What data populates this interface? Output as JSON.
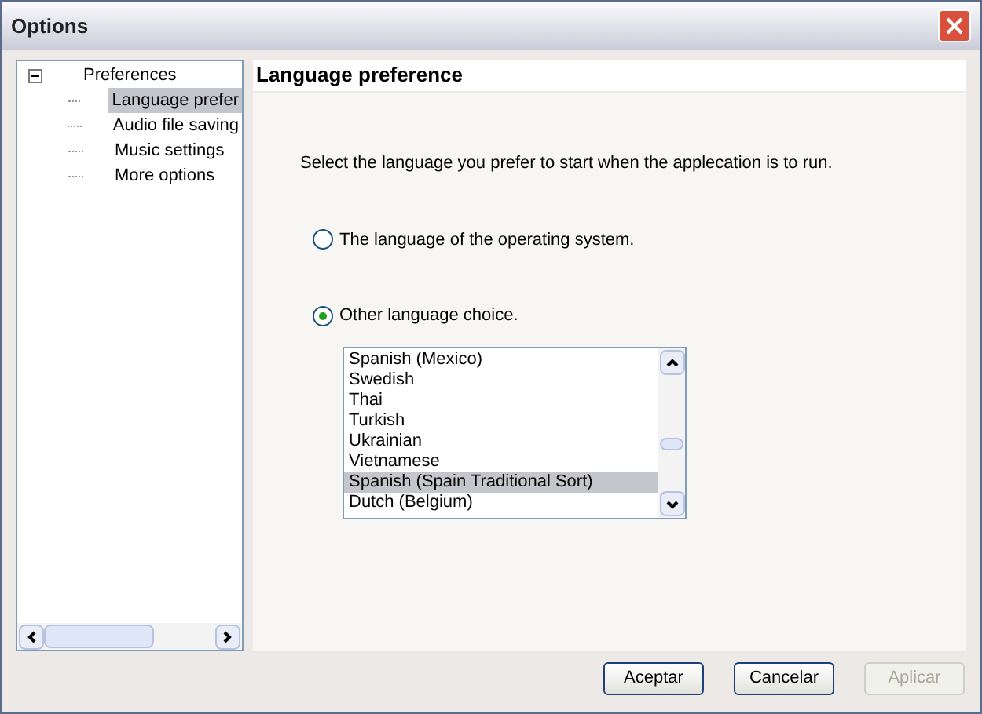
{
  "window": {
    "title": "Options"
  },
  "tree": [
    {
      "label": "Preferences",
      "expanded": true,
      "selected": false,
      "children": [
        {
          "label": "Language prefer",
          "selected": true
        },
        {
          "label": "Audio file saving",
          "selected": false
        },
        {
          "label": "Music settings",
          "selected": false
        },
        {
          "label": "More options",
          "selected": false
        }
      ]
    }
  ],
  "panel": {
    "title": "Language preference",
    "instruction": "Select the language you prefer to start when the applecation is to run.",
    "options": [
      {
        "label": "The language of the operating system.",
        "selected": false
      },
      {
        "label": "Other language choice.",
        "selected": true
      }
    ],
    "languages": [
      {
        "label": "Spanish (Mexico)",
        "selected": false
      },
      {
        "label": "Swedish",
        "selected": false
      },
      {
        "label": "Thai",
        "selected": false
      },
      {
        "label": "Turkish",
        "selected": false
      },
      {
        "label": "Ukrainian",
        "selected": false
      },
      {
        "label": "Vietnamese",
        "selected": false
      },
      {
        "label": "Spanish (Spain Traditional Sort)",
        "selected": true
      },
      {
        "label": "Dutch (Belgium)",
        "selected": false
      }
    ]
  },
  "buttons": [
    {
      "label": "Aceptar",
      "disabled": false
    },
    {
      "label": "Cancelar",
      "disabled": false
    },
    {
      "label": "Aplicar",
      "disabled": true
    }
  ]
}
